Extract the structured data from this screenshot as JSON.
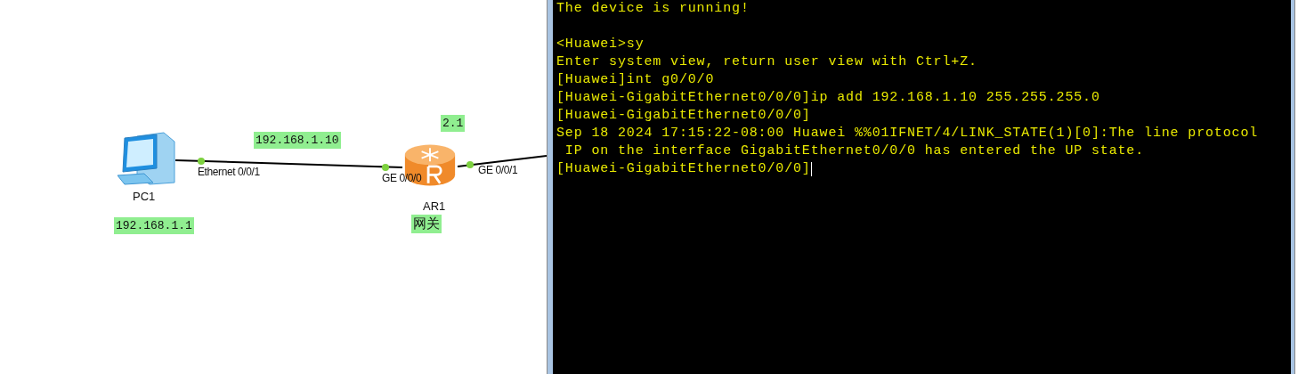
{
  "topology": {
    "devices": [
      {
        "kind": "pc",
        "name": "PC1"
      },
      {
        "kind": "router",
        "name": "AR1"
      }
    ],
    "links": [
      {
        "ports": [
          {
            "label": "Ethernet 0/0/1"
          },
          {
            "label": "GE 0/0/0"
          }
        ]
      },
      {
        "ports": [
          {
            "label": "GE 0/0/1"
          }
        ]
      }
    ],
    "notes": [
      {
        "text": "192.168.1.10"
      },
      {
        "text": "2.1"
      },
      {
        "text": "192.168.1.1"
      },
      {
        "text": "网关"
      }
    ]
  },
  "terminal": {
    "lines": [
      {
        "kind": "text",
        "text": "The device is running!"
      },
      {
        "kind": "blank"
      },
      {
        "kind": "text",
        "text": "<Huawei>sy"
      },
      {
        "kind": "text",
        "text": "Enter system view, return user view with Ctrl+Z."
      },
      {
        "kind": "text",
        "text": "[Huawei]int g0/0/0"
      },
      {
        "kind": "text",
        "text": "[Huawei-GigabitEthernet0/0/0]ip add 192.168.1.10 255.255.255.0"
      },
      {
        "kind": "text",
        "text": "[Huawei-GigabitEthernet0/0/0]"
      },
      {
        "kind": "text",
        "text": "Sep 18 2024 17:15:22-08:00 Huawei %%01IFNET/4/LINK_STATE(1)[0]:The line protocol"
      },
      {
        "kind": "text",
        "text": " IP on the interface GigabitEthernet0/0/0 has entered the UP state."
      },
      {
        "kind": "text",
        "text": "[Huawei-GigabitEthernet0/0/0]"
      }
    ]
  }
}
